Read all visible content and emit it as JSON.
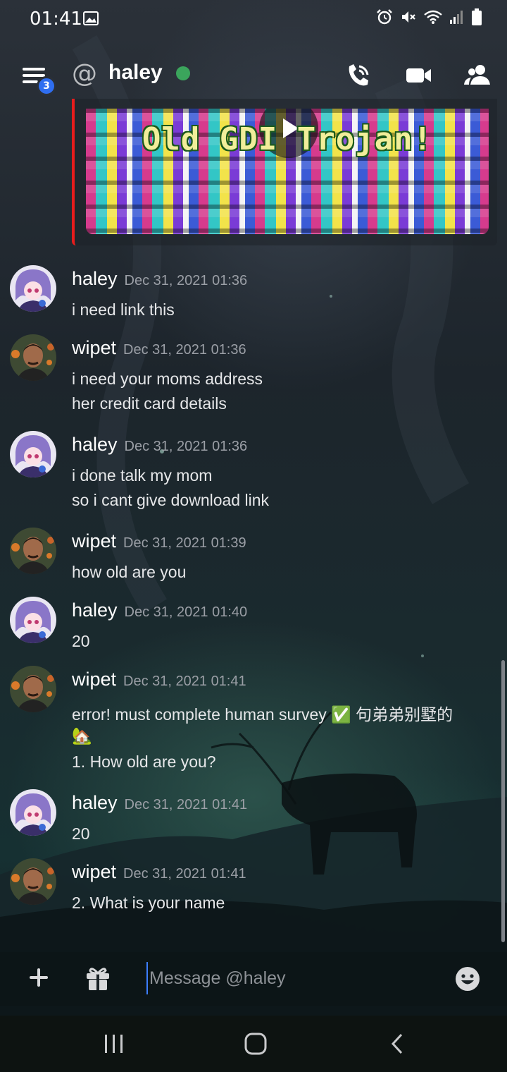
{
  "status_bar": {
    "time": "01:41",
    "icons": [
      "image-icon",
      "alarm-icon",
      "mute-icon",
      "wifi-icon",
      "signal-icon",
      "battery-icon"
    ]
  },
  "header": {
    "badge_count": "3",
    "at_symbol": "@",
    "title": "haley",
    "online_color": "#3ba55c"
  },
  "embed": {
    "title": "Old GDI Trojan!",
    "accent_color": "#e81c1c"
  },
  "messages": [
    {
      "author": "haley",
      "timestamp": "Dec 31, 2021 01:36",
      "lines": [
        "i need link this"
      ]
    },
    {
      "author": "wipet",
      "timestamp": "Dec 31, 2021 01:36",
      "lines": [
        "i need your moms address",
        "her credit card details"
      ]
    },
    {
      "author": "haley",
      "timestamp": "Dec 31, 2021 01:36",
      "lines": [
        "i done talk my mom",
        "so i cant give download link"
      ]
    },
    {
      "author": "wipet",
      "timestamp": "Dec 31, 2021 01:39",
      "lines": [
        "how old are you"
      ]
    },
    {
      "author": "haley",
      "timestamp": "Dec 31, 2021 01:40",
      "lines": [
        "20"
      ]
    },
    {
      "author": "wipet",
      "timestamp": "Dec 31, 2021 01:41",
      "lines": [
        "error! must complete human survey ✅ 句弟弟别墅的",
        "🏡",
        "1. How old are you?"
      ]
    },
    {
      "author": "haley",
      "timestamp": "Dec 31, 2021 01:41",
      "lines": [
        "20"
      ]
    },
    {
      "author": "wipet",
      "timestamp": "Dec 31, 2021 01:41",
      "lines": [
        "2. What is your name"
      ]
    }
  ],
  "composer": {
    "placeholder": "Message @haley",
    "value": ""
  }
}
